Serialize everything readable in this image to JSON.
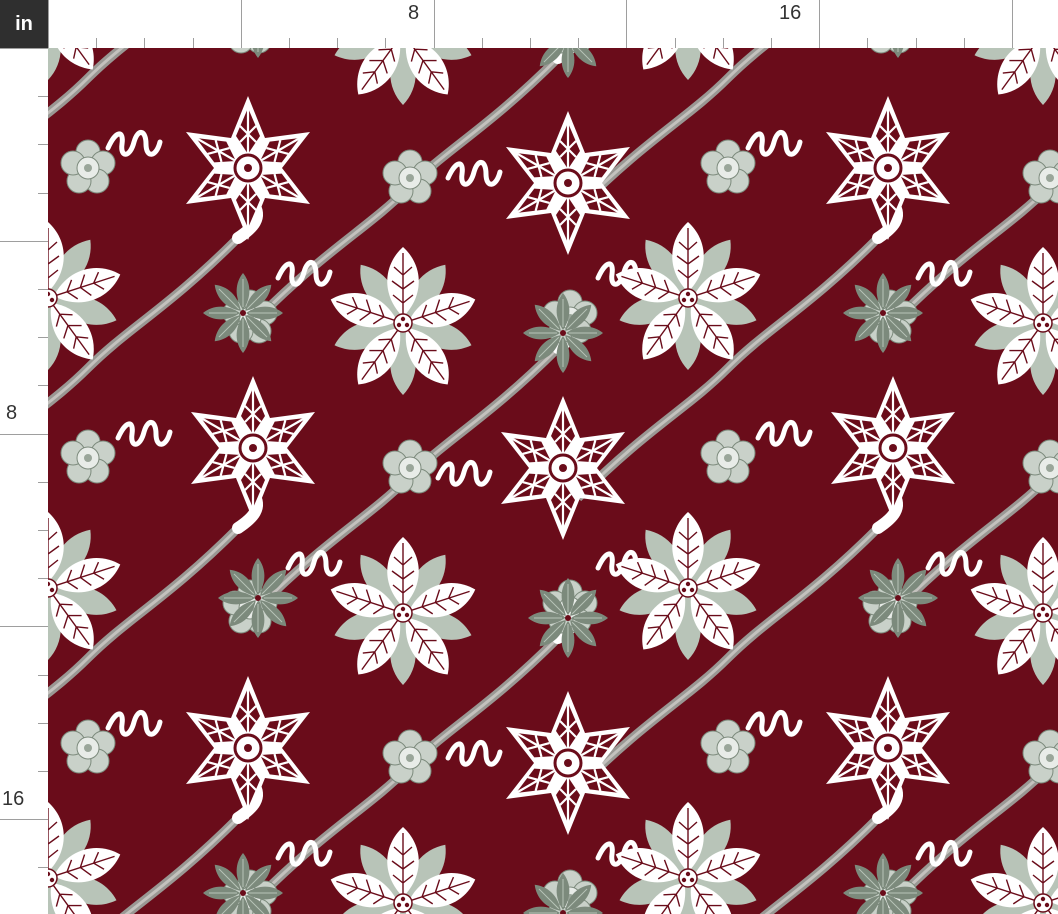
{
  "ruler": {
    "unit_label": "in",
    "top_labels": [
      "8",
      "16"
    ],
    "left_labels": [
      "8",
      "16"
    ]
  },
  "pattern": {
    "motifs": [
      "poinsettia",
      "lace-snowflake",
      "small-leaf-star",
      "ribbon-flower",
      "curled-ribbon"
    ],
    "colors": {
      "background": "#6a0c1a",
      "white": "#ffffff",
      "sage": "#b8c4b8",
      "grey_ribbon": "#9a9894",
      "dark_leaf": "#7c8a7c",
      "vein": "#6a0c1a"
    }
  }
}
